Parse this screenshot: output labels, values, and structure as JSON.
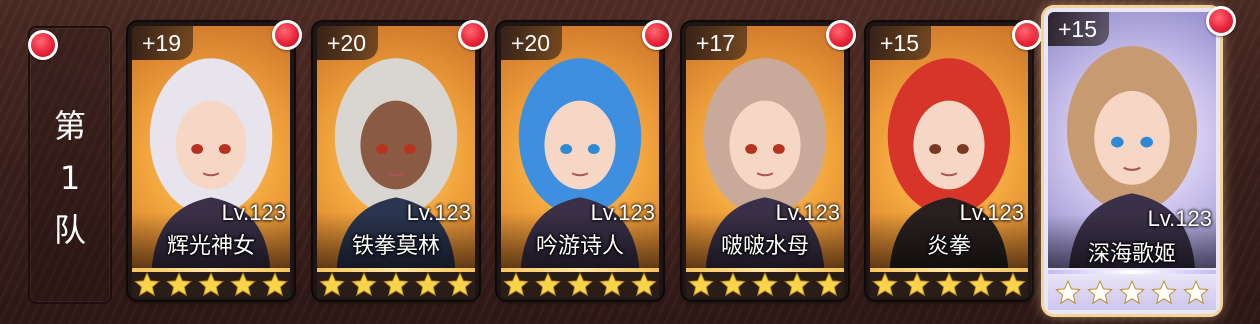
{
  "team": {
    "label": "第\n1\n队"
  },
  "cards": [
    {
      "bonus": "+19",
      "level": "Lv.123",
      "name": "辉光神女",
      "stars": 5,
      "star_color": "#f7d54a",
      "hair": "#e8e4ee",
      "selected": false
    },
    {
      "bonus": "+20",
      "level": "Lv.123",
      "name": "铁拳莫林",
      "stars": 5,
      "star_color": "#f7d54a",
      "hair": "#d9d6d2",
      "selected": false
    },
    {
      "bonus": "+20",
      "level": "Lv.123",
      "name": "吟游诗人",
      "stars": 5,
      "star_color": "#f7d54a",
      "hair": "#3e8fe0",
      "selected": false
    },
    {
      "bonus": "+17",
      "level": "Lv.123",
      "name": "啵啵水母",
      "stars": 5,
      "star_color": "#f7d54a",
      "hair": "#c9a99a",
      "selected": false
    },
    {
      "bonus": "+15",
      "level": "Lv.123",
      "name": "炎拳",
      "stars": 5,
      "star_color": "#f7d54a",
      "hair": "#d8352a",
      "selected": false
    },
    {
      "bonus": "+15",
      "level": "Lv.123",
      "name": "深海歌姬",
      "stars": 5,
      "star_color": "#ffffff",
      "hair": "#c79a72",
      "selected": true
    }
  ],
  "colors": {
    "notification": "#e9243a",
    "selected_glow": "#f4d49a"
  }
}
